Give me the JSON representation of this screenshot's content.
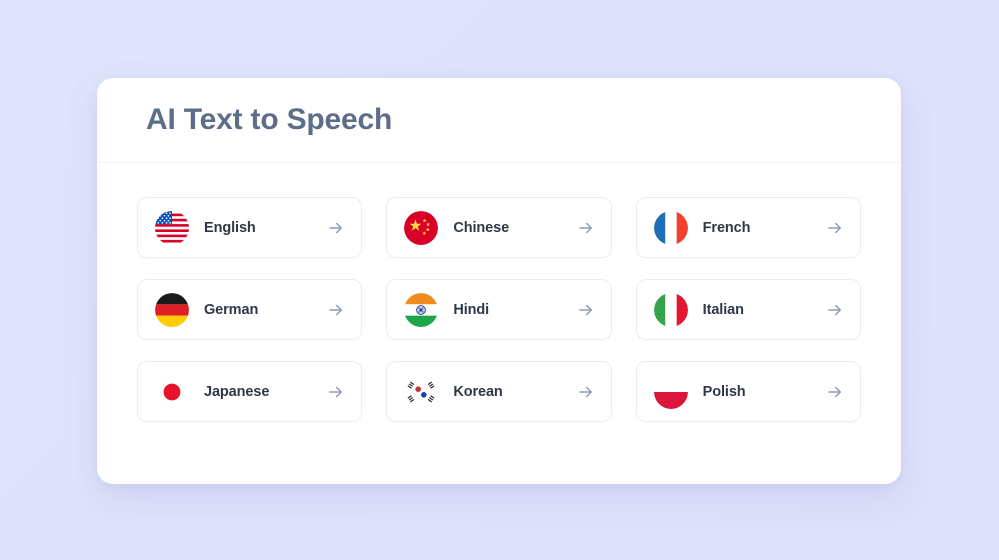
{
  "page": {
    "background_color": "#dfe3fb",
    "card_background": "#ffffff"
  },
  "header": {
    "title": "AI Text to Speech",
    "title_color": "#5d6e88"
  },
  "languages": [
    {
      "label": "English",
      "flag": "flag-us-icon",
      "arrow": "arrow-right-icon"
    },
    {
      "label": "Chinese",
      "flag": "flag-cn-icon",
      "arrow": "arrow-right-icon"
    },
    {
      "label": "French",
      "flag": "flag-fr-icon",
      "arrow": "arrow-right-icon"
    },
    {
      "label": "German",
      "flag": "flag-de-icon",
      "arrow": "arrow-right-icon"
    },
    {
      "label": "Hindi",
      "flag": "flag-in-icon",
      "arrow": "arrow-right-icon"
    },
    {
      "label": "Italian",
      "flag": "flag-it-icon",
      "arrow": "arrow-right-icon"
    },
    {
      "label": "Japanese",
      "flag": "flag-jp-icon",
      "arrow": "arrow-right-icon"
    },
    {
      "label": "Korean",
      "flag": "flag-kr-icon",
      "arrow": "arrow-right-icon"
    },
    {
      "label": "Polish",
      "flag": "flag-pl-icon",
      "arrow": "arrow-right-icon"
    }
  ],
  "colors": {
    "label_text": "#2f3847",
    "arrow": "#8d9bb4",
    "item_border": "#eaedf4"
  }
}
